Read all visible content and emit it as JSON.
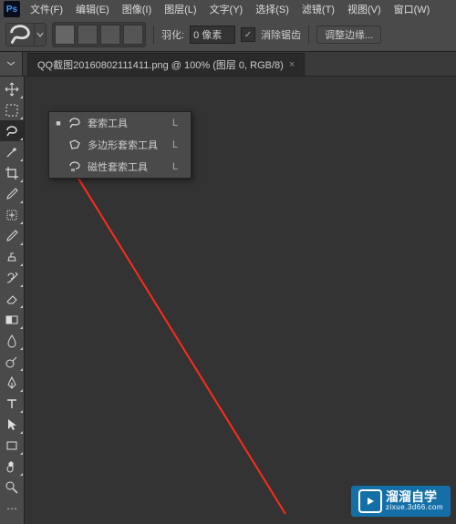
{
  "app": {
    "logo": "Ps"
  },
  "menubar": [
    {
      "label": "文件(F)"
    },
    {
      "label": "编辑(E)"
    },
    {
      "label": "图像(I)"
    },
    {
      "label": "图层(L)"
    },
    {
      "label": "文字(Y)"
    },
    {
      "label": "选择(S)"
    },
    {
      "label": "滤镜(T)"
    },
    {
      "label": "视图(V)"
    },
    {
      "label": "窗口(W)"
    }
  ],
  "options": {
    "feather_label": "羽化:",
    "feather_value": "0 像素",
    "antialias_label": "消除锯齿",
    "refine_edge": "调整边缘..."
  },
  "doc_tab": {
    "title": "QQ截图20160802111411.png @ 100% (图层 0, RGB/8)",
    "close": "×"
  },
  "flyout": [
    {
      "dot": "■",
      "label": "套索工具",
      "key": "L"
    },
    {
      "dot": "",
      "label": "多边形套索工具",
      "key": "L"
    },
    {
      "dot": "",
      "label": "磁性套索工具",
      "key": "L"
    }
  ],
  "watermark": {
    "main": "溜溜自学",
    "sub": "zixue.3d66.com"
  },
  "colors": {
    "accent": "#1473e6",
    "bg": "#333",
    "panel": "#4a4a4a"
  }
}
